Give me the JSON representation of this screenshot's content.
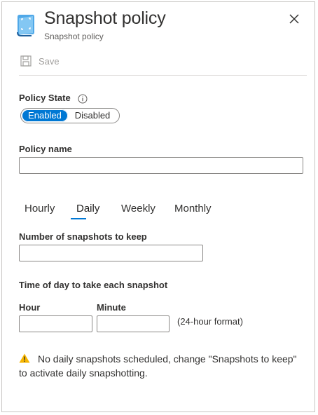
{
  "header": {
    "title": "Snapshot policy",
    "subtitle": "Snapshot policy",
    "icon": "snapshot-policy-icon",
    "close_icon": "close-icon"
  },
  "toolbar": {
    "save_label": "Save",
    "save_icon": "save-icon",
    "save_enabled": false
  },
  "policy_state": {
    "label": "Policy State",
    "info_icon": "info-icon",
    "options": [
      "Enabled",
      "Disabled"
    ],
    "selected": "Enabled"
  },
  "policy_name": {
    "label": "Policy name",
    "value": "",
    "placeholder": ""
  },
  "tabs": [
    {
      "label": "Hourly",
      "active": false
    },
    {
      "label": "Daily",
      "active": true
    },
    {
      "label": "Weekly",
      "active": false
    },
    {
      "label": "Monthly",
      "active": false
    }
  ],
  "snapshots_to_keep": {
    "label": "Number of snapshots to keep",
    "value": ""
  },
  "time_of_day": {
    "label": "Time of day to take each snapshot",
    "hour_label": "Hour",
    "hour_value": "",
    "minute_label": "Minute",
    "minute_value": "",
    "format_hint": "(24-hour format)"
  },
  "warning": {
    "icon": "warning-icon",
    "text": "No daily snapshots scheduled, change \"Snapshots to keep\" to activate daily snapshotting."
  },
  "colors": {
    "accent": "#0078d4",
    "warning": "#f7b600",
    "border": "#8a8886",
    "disabled_text": "#a19f9d"
  }
}
